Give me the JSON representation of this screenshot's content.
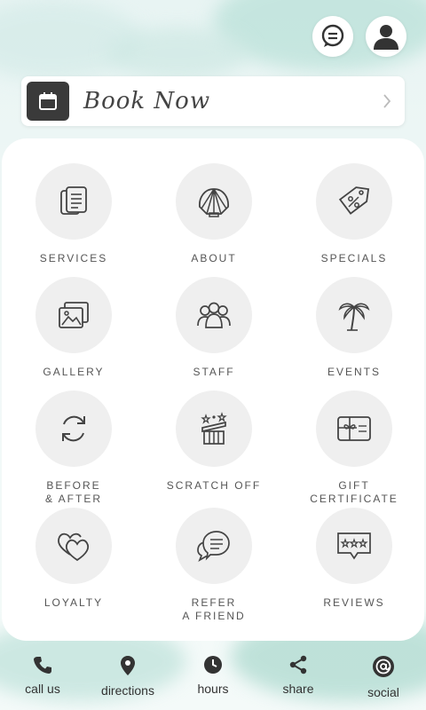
{
  "book": {
    "label": "Book Now"
  },
  "tiles": [
    {
      "label": "SERVICES"
    },
    {
      "label": "ABOUT"
    },
    {
      "label": "SPECIALS"
    },
    {
      "label": "GALLERY"
    },
    {
      "label": "STAFF"
    },
    {
      "label": "EVENTS"
    },
    {
      "label": "BEFORE\n& AFTER"
    },
    {
      "label": "SCRATCH OFF"
    },
    {
      "label": "GIFT\nCERTIFICATE"
    },
    {
      "label": "LOYALTY"
    },
    {
      "label": "REFER\nA FRIEND"
    },
    {
      "label": "REVIEWS"
    }
  ],
  "bottom_nav": [
    {
      "label": "call us",
      "icon": "phone-icon"
    },
    {
      "label": "directions",
      "icon": "map-pin-icon"
    },
    {
      "label": "hours",
      "icon": "clock-icon"
    },
    {
      "label": "share",
      "icon": "share-icon"
    },
    {
      "label": "social",
      "icon": "at-sign-icon"
    }
  ],
  "colors": {
    "accent": "#3a3a3a",
    "tile_bg": "#efefef",
    "wash": "#a9d9d0"
  }
}
